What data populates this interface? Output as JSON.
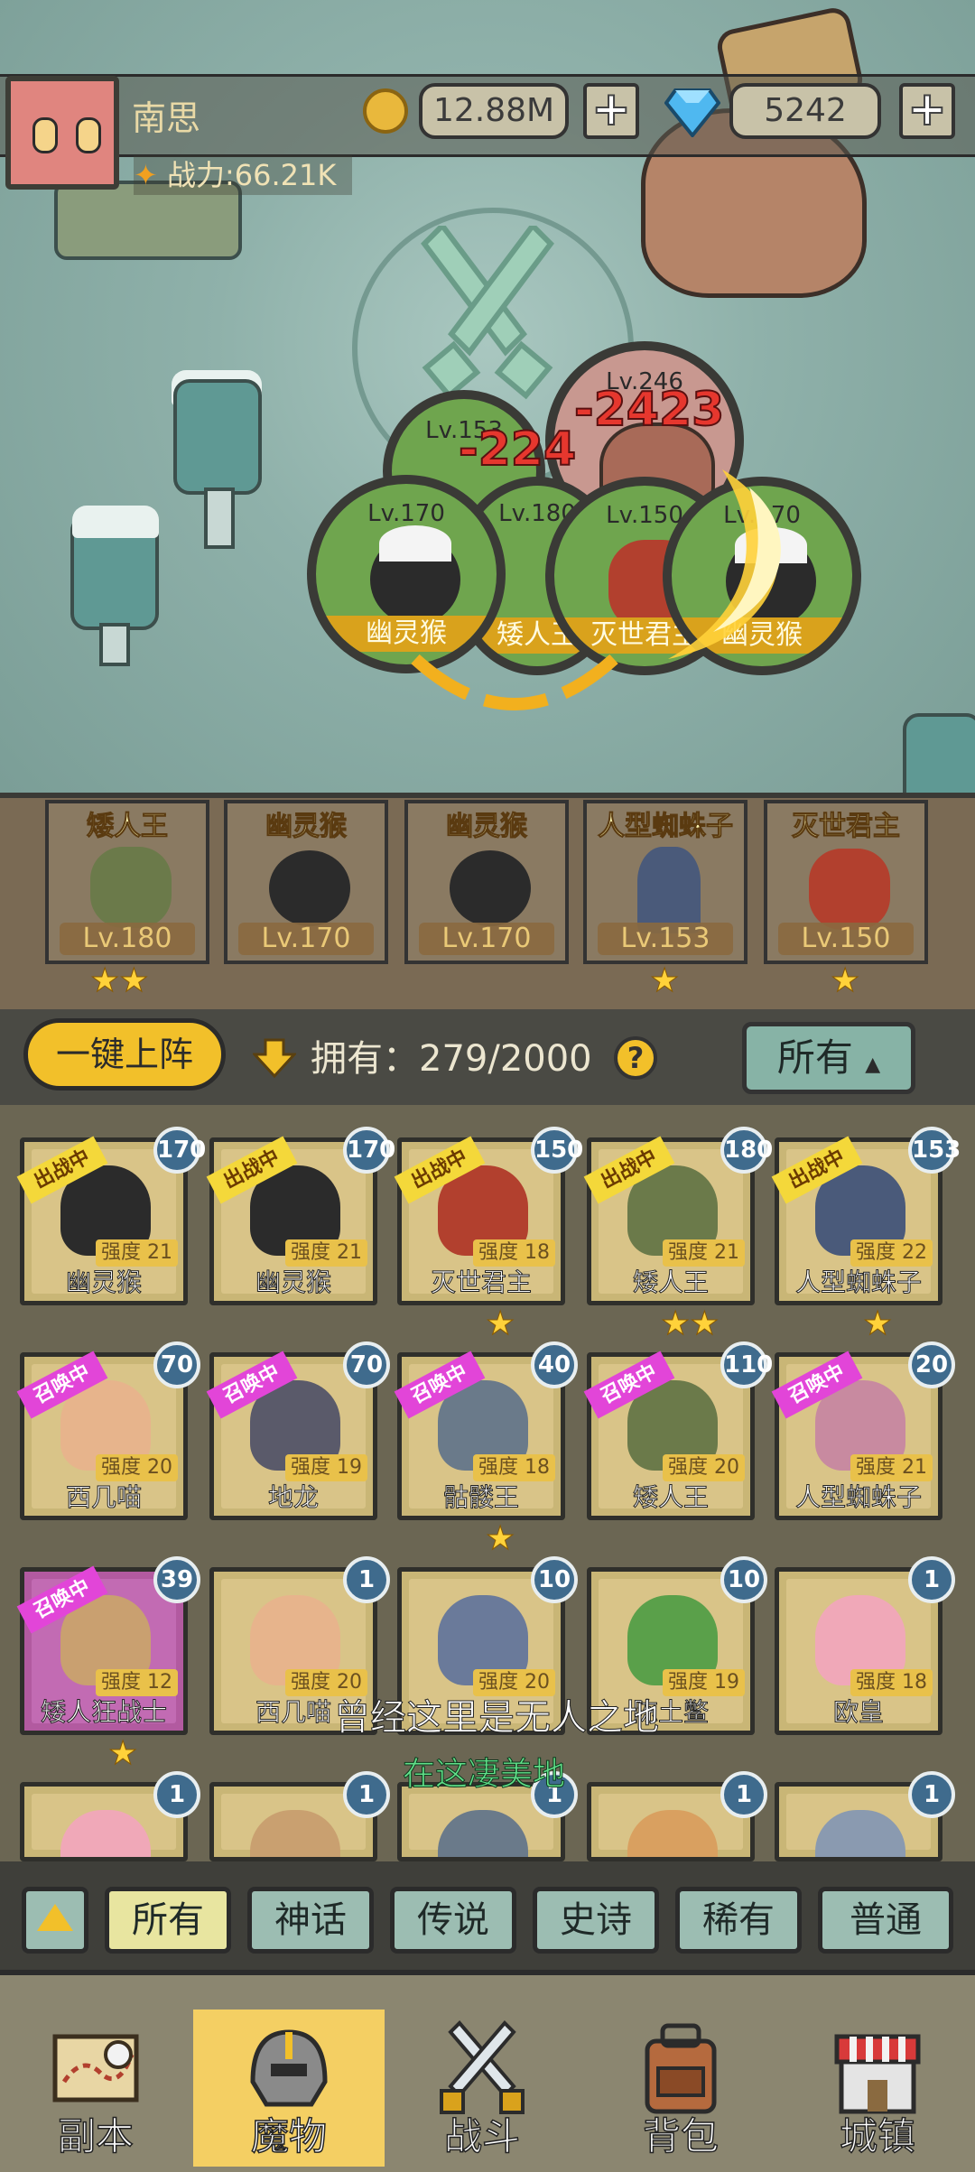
{
  "player": {
    "name": "南思",
    "power": "战力:66.21K",
    "gold": "12.88M",
    "gems": "5242",
    "plus": "+"
  },
  "battle": {
    "circles": [
      {
        "lv": "Lv.153",
        "name": ""
      },
      {
        "lv": "Lv.246",
        "name": ""
      },
      {
        "lv": "Lv.170",
        "name": "幽灵猴"
      },
      {
        "lv": "Lv.180",
        "name": "矮人王"
      },
      {
        "lv": "Lv.150",
        "name": "灭世君主"
      },
      {
        "lv": "Lv.170",
        "name": "幽灵猴"
      }
    ],
    "damage": [
      "-224",
      "-2423"
    ]
  },
  "formation": [
    {
      "name": "矮人王",
      "lv": "Lv.180",
      "stars": "★★"
    },
    {
      "name": "幽灵猴",
      "lv": "Lv.170",
      "stars": ""
    },
    {
      "name": "幽灵猴",
      "lv": "Lv.170",
      "stars": ""
    },
    {
      "name": "人型蜘蛛子",
      "lv": "Lv.153",
      "stars": "★"
    },
    {
      "name": "灭世君主",
      "lv": "Lv.150",
      "stars": "★"
    }
  ],
  "controls": {
    "one_click": "一键上阵",
    "own": "拥有：279/2000",
    "help": "?",
    "filter": "所有"
  },
  "cards": [
    {
      "lv": "170",
      "tag": "出战中",
      "power": "强度 21",
      "name": "幽灵猴",
      "stars": "",
      "pink": false,
      "color": "#2b2b2b"
    },
    {
      "lv": "170",
      "tag": "出战中",
      "power": "强度 21",
      "name": "幽灵猴",
      "stars": "",
      "pink": false,
      "color": "#2b2b2b"
    },
    {
      "lv": "150",
      "tag": "出战中",
      "power": "强度 18",
      "name": "灭世君主",
      "stars": "★",
      "pink": false,
      "color": "#b2402e"
    },
    {
      "lv": "180",
      "tag": "出战中",
      "power": "强度 21",
      "name": "矮人王",
      "stars": "★★",
      "pink": false,
      "color": "#6b7a4a"
    },
    {
      "lv": "153",
      "tag": "出战中",
      "power": "强度 22",
      "name": "人型蜘蛛子",
      "stars": "★",
      "pink": false,
      "color": "#4a5a7a"
    },
    {
      "lv": "70",
      "tag": "召唤中",
      "power": "强度 20",
      "name": "西几喵",
      "stars": "",
      "pink": false,
      "color": "#e7b48c"
    },
    {
      "lv": "70",
      "tag": "召唤中",
      "power": "强度 19",
      "name": "地龙",
      "stars": "",
      "pink": false,
      "color": "#5a5a6a"
    },
    {
      "lv": "40",
      "tag": "召唤中",
      "power": "强度 18",
      "name": "骷髅王",
      "stars": "★",
      "pink": false,
      "color": "#6a7a8a"
    },
    {
      "lv": "110",
      "tag": "召唤中",
      "power": "强度 20",
      "name": "矮人王",
      "stars": "",
      "pink": false,
      "color": "#6b7a4a"
    },
    {
      "lv": "20",
      "tag": "召唤中",
      "power": "强度 21",
      "name": "人型蜘蛛子",
      "stars": "",
      "pink": false,
      "color": "#c88aa0"
    },
    {
      "lv": "39",
      "tag": "召唤中",
      "power": "强度 12",
      "name": "矮人狂战士",
      "stars": "★",
      "pink": true,
      "color": "#c9a070"
    },
    {
      "lv": "1",
      "tag": "",
      "power": "强度 20",
      "name": "西几喵",
      "stars": "",
      "pink": false,
      "color": "#e7b48c"
    },
    {
      "lv": "10",
      "tag": "",
      "power": "强度 20",
      "name": "",
      "stars": "",
      "pink": false,
      "color": "#6a7a9a"
    },
    {
      "lv": "10",
      "tag": "",
      "power": "强度 19",
      "name": "陈土鳖",
      "stars": "",
      "pink": false,
      "color": "#5aa04a"
    },
    {
      "lv": "1",
      "tag": "",
      "power": "强度 18",
      "name": "欧皇",
      "stars": "",
      "pink": false,
      "color": "#f0a8b8"
    },
    {
      "lv": "1",
      "tag": "",
      "power": "",
      "name": "",
      "stars": "",
      "pink": false,
      "color": "#f0a8b8"
    },
    {
      "lv": "1",
      "tag": "",
      "power": "",
      "name": "",
      "stars": "",
      "pink": false,
      "color": "#c9a070"
    },
    {
      "lv": "1",
      "tag": "",
      "power": "",
      "name": "",
      "stars": "",
      "pink": false,
      "color": "#6a7a8a"
    },
    {
      "lv": "1",
      "tag": "",
      "power": "",
      "name": "",
      "stars": "",
      "pink": false,
      "color": "#d9a060"
    },
    {
      "lv": "1",
      "tag": "",
      "power": "",
      "name": "",
      "stars": "",
      "pink": false,
      "color": "#8a9ab0"
    }
  ],
  "subtitles": [
    "曾经这里是无人之地",
    "在这凄美地"
  ],
  "rarity": [
    "所有",
    "神话",
    "传说",
    "史诗",
    "稀有",
    "普通"
  ],
  "nav": [
    {
      "label": "副本",
      "icon": "map-icon"
    },
    {
      "label": "魔物",
      "icon": "helmet-icon"
    },
    {
      "label": "战斗",
      "icon": "swords-icon"
    },
    {
      "label": "背包",
      "icon": "backpack-icon"
    },
    {
      "label": "城镇",
      "icon": "shop-icon"
    }
  ]
}
